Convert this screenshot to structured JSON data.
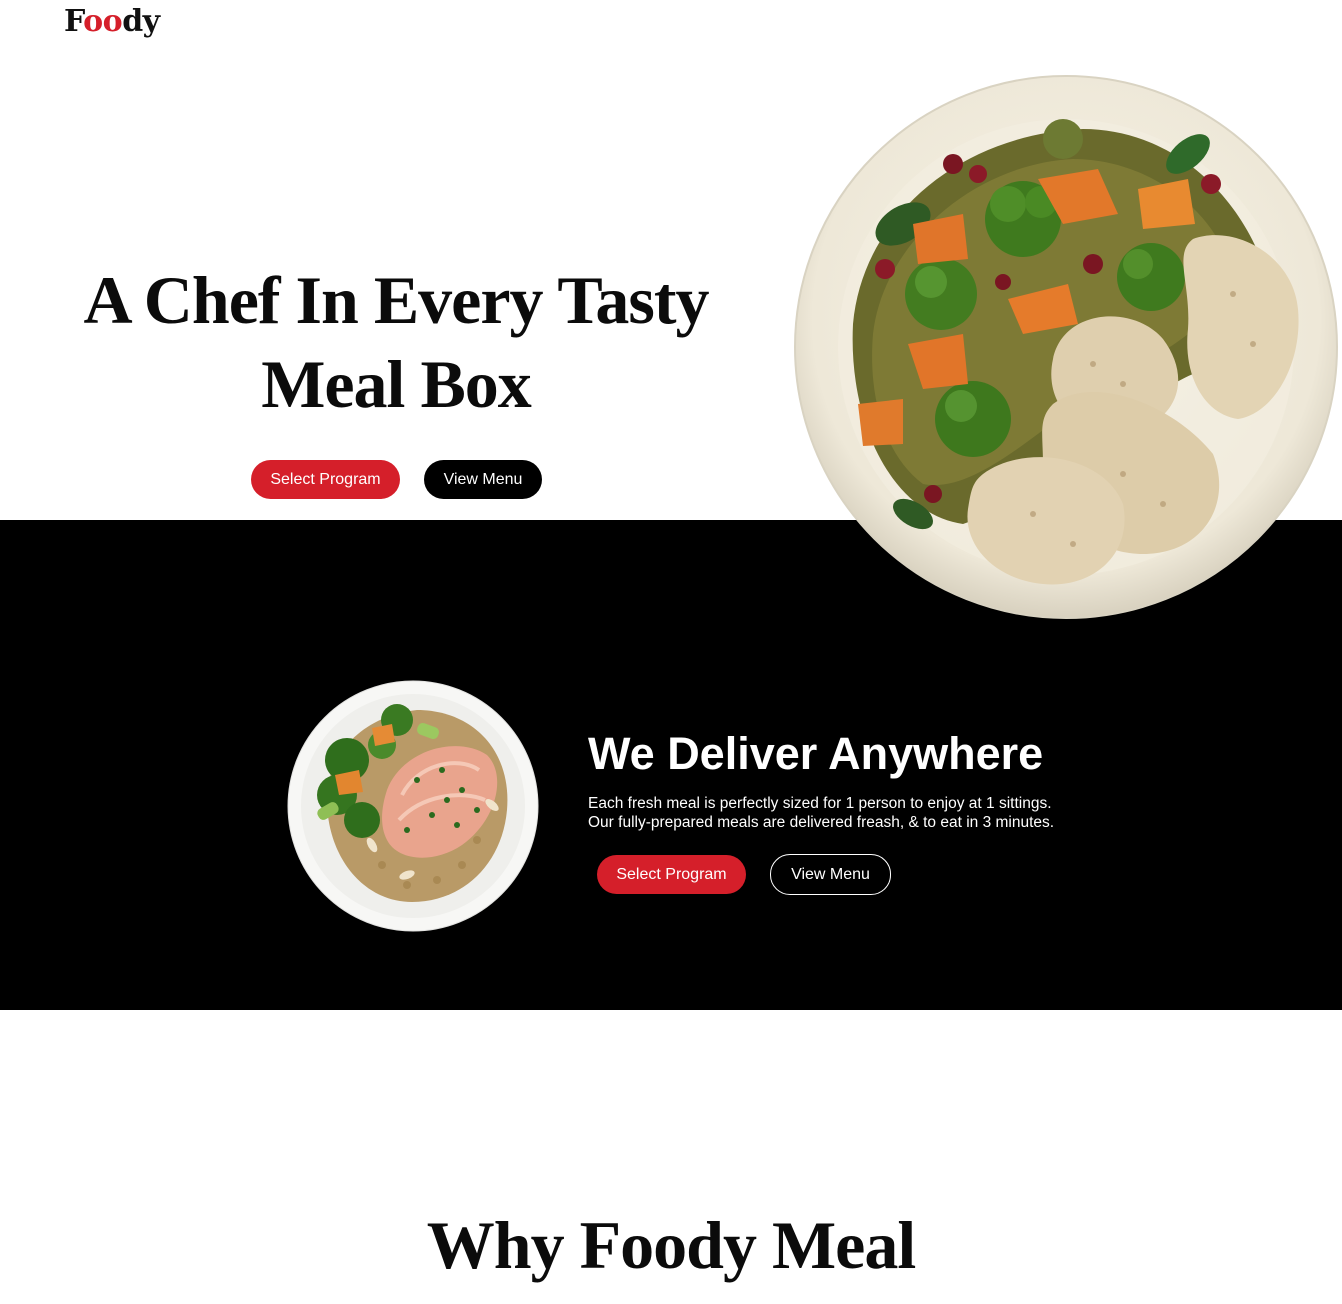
{
  "header": {
    "logo_parts": [
      "F",
      "oo",
      "dy"
    ],
    "accent_color": "#d51f2a"
  },
  "hero": {
    "title_line1": "A Chef In Every Tasty",
    "title_line2": "Meal Box",
    "primary_button": "Select Program",
    "secondary_button": "View Menu",
    "image_icon": "chicken-vegetable-plate-image"
  },
  "delivery": {
    "title": "We Deliver Anywhere",
    "line1": "Each fresh meal is perfectly sized for 1 person to enjoy at 1 sittings.",
    "line2": "Our fully-prepared meals are delivered freash, & to eat in 3 minutes.",
    "primary_button": "Select Program",
    "secondary_button": "View Menu",
    "image_icon": "salmon-quinoa-plate-image"
  },
  "why": {
    "title": "Why Foody Meal"
  }
}
